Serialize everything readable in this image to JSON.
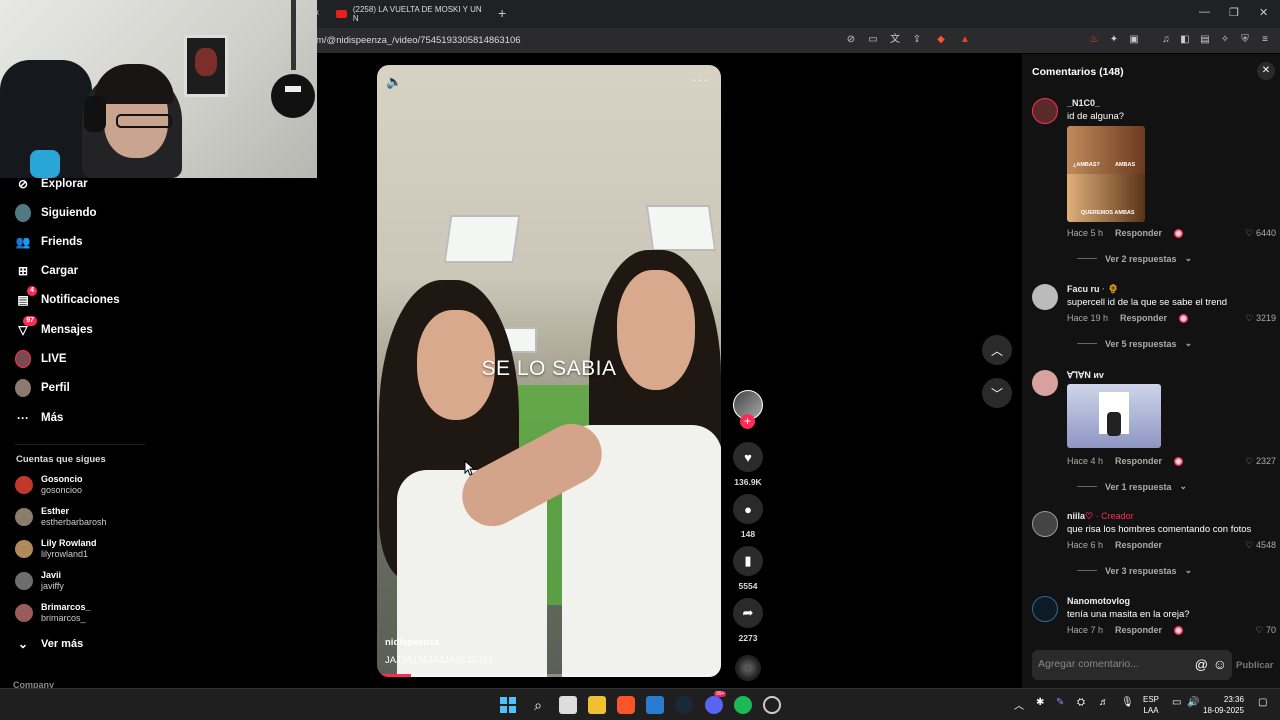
{
  "browser": {
    "tab_title": "(2258) LA VUELTA DE MOSKI Y UN N",
    "url": "m/@nidispeenza_/video/7545193305814863106",
    "new_tab": "+",
    "minimize": "—",
    "restore": "❐",
    "close": "✕"
  },
  "sidebar": {
    "items": [
      {
        "label": "Explorar",
        "icon": "compass-icon"
      },
      {
        "label": "Siguiendo",
        "icon": "following-avatar-icon"
      },
      {
        "label": "Friends",
        "icon": "friends-icon"
      },
      {
        "label": "Cargar",
        "icon": "upload-icon"
      },
      {
        "label": "Notificaciones",
        "icon": "bell-icon",
        "badge": "4"
      },
      {
        "label": "Mensajes",
        "icon": "messages-icon",
        "badge": "97"
      },
      {
        "label": "LIVE",
        "icon": "live-icon"
      },
      {
        "label": "Perfil",
        "icon": "profile-icon"
      },
      {
        "label": "Más",
        "icon": "more-icon"
      }
    ],
    "following_title": "Cuentas que sigues",
    "following": [
      {
        "name": "Gosoncio",
        "handle": "gosoncioo",
        "color": "#c0392b"
      },
      {
        "name": "Esther",
        "handle": "estherbarbarosh",
        "color": "#8b7d6b"
      },
      {
        "name": "Lily Rowland",
        "handle": "lilyrowland1",
        "color": "#b08a5a"
      },
      {
        "name": "Javii",
        "handle": "javiffy",
        "color": "#6d6d6d"
      },
      {
        "name": "Brimarcos_",
        "handle": "brimarcos_",
        "color": "#9a5b5b"
      }
    ],
    "see_more": "Ver más",
    "company": "Company"
  },
  "video": {
    "overlay_text": "SE LO SABIA",
    "username": "nidispeenza_",
    "description": "JAJJAJJAJAJJAJSJSJSJ",
    "progress": 0.1
  },
  "actions": {
    "likes": "136.9K",
    "comments": "148",
    "saves": "5554",
    "shares": "2273"
  },
  "comments_panel": {
    "title": "Comentarios (148)",
    "input_placeholder": "Agregar comentario...",
    "publish": "Publicar",
    "comments": [
      {
        "user": "_N1C0_",
        "text": "id de alguna?",
        "time": "Hace 5 h",
        "reply": "Responder",
        "likes": "6440",
        "more": "Ver 2 respuestas",
        "image_caption_top": "¿AMBAS?",
        "image_caption_top2": "AMBAS",
        "image_caption_bottom": "QUEREMOS AMBAS"
      },
      {
        "user": "Facu ru",
        "text": "supercell id de la que se sabe el trend",
        "time": "Hace 19 h",
        "reply": "Responder",
        "likes": "3219",
        "more": "Ver 5 respuestas"
      },
      {
        "user": "ꓯꓶꓯN ᴎv",
        "text": "",
        "time": "Hace 4 h",
        "reply": "Responder",
        "likes": "2327",
        "more": "Ver 1 respuesta"
      },
      {
        "user": "niila",
        "creator": "· Creador",
        "text": "que risa los hombres comentando con fotos",
        "time": "Hace 6 h",
        "reply": "Responder",
        "likes": "4548",
        "more": "Ver 3 respuestas"
      },
      {
        "user": "Nanomotovlog",
        "text": "tenía una masita en la oreja?",
        "time": "Hace 7 h",
        "reply": "Responder",
        "likes": "70"
      }
    ]
  },
  "taskbar": {
    "lang_top": "ESP",
    "lang_bottom": "LAA",
    "time": "23:36",
    "date": "18-09-2025",
    "discord_badge": "99+"
  }
}
